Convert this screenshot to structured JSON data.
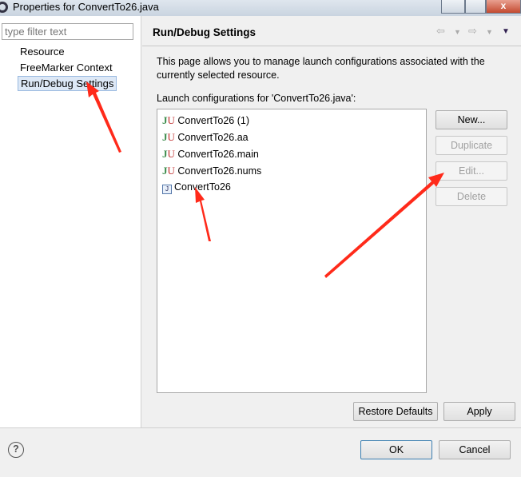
{
  "window": {
    "title": "Properties for ConvertTo26.java",
    "close": "x"
  },
  "sidebar": {
    "filter_placeholder": "type filter text",
    "items": [
      {
        "label": "Resource"
      },
      {
        "label": "FreeMarker Context"
      },
      {
        "label": "Run/Debug Settings",
        "selected": true
      }
    ]
  },
  "page": {
    "title": "Run/Debug Settings",
    "description": "This page allows you to manage launch configurations associated with the currently selected resource.",
    "list_label": "Launch configurations for 'ConvertTo26.java':",
    "configs": [
      {
        "label": "ConvertTo26 (1)",
        "icon": "junit-icon"
      },
      {
        "label": "ConvertTo26.aa",
        "icon": "junit-icon"
      },
      {
        "label": "ConvertTo26.main",
        "icon": "junit-icon"
      },
      {
        "label": "ConvertTo26.nums",
        "icon": "junit-icon"
      },
      {
        "label": "ConvertTo26",
        "icon": "java-application-icon"
      }
    ],
    "buttons": {
      "new": "New...",
      "duplicate": "Duplicate",
      "edit": "Edit...",
      "delete": "Delete",
      "restore": "Restore Defaults",
      "apply": "Apply"
    }
  },
  "footer": {
    "help": "?",
    "ok": "OK",
    "cancel": "Cancel"
  },
  "colors": {
    "annotation_arrow": "#ff2a1a",
    "selection": "#dde8f6"
  }
}
